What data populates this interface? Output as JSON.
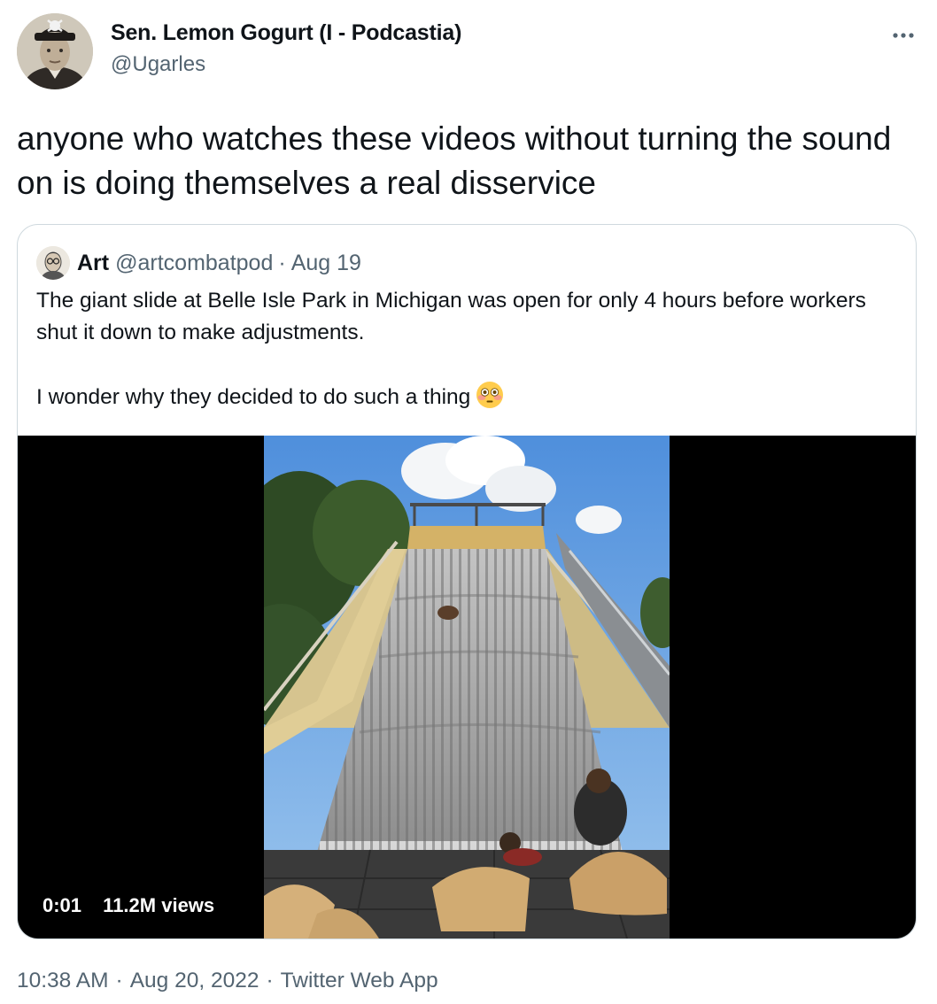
{
  "author": {
    "display_name": "Sen. Lemon Gogurt (I - Podcastia)",
    "handle": "@Ugarles"
  },
  "tweet": {
    "text": "anyone who watches these videos without turning the sound on is doing themselves a real disservice"
  },
  "more_icon": "more-dots-icon",
  "quoted_tweet": {
    "name": "Art",
    "handle": "@artcombatpod",
    "separator": "·",
    "date": "Aug 19",
    "paragraph_1": "The giant slide at Belle Isle Park in Michigan was open for only 4 hours before workers shut it down to make adjustments.",
    "paragraph_2": "I wonder why they decided to do such a thing",
    "emoji": "flushed-face-emoji",
    "video": {
      "timestamp": "0:01",
      "views": "11.2M views"
    }
  },
  "footer": {
    "time": "10:38 AM",
    "separator": "·",
    "date": "Aug 20, 2022",
    "source": "Twitter Web App"
  },
  "colors": {
    "text": "#0f1419",
    "secondary_text": "#536471",
    "border": "#cfd9de",
    "media_background": "#000000"
  }
}
